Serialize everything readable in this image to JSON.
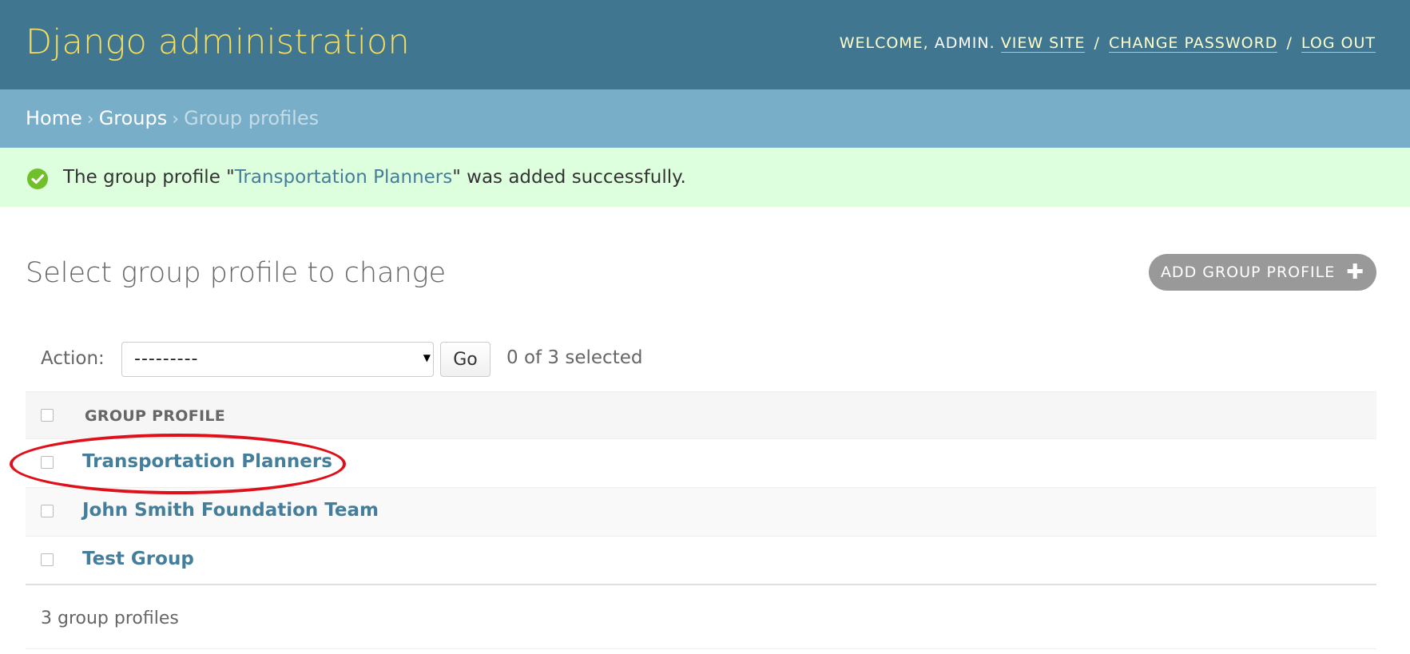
{
  "header": {
    "brand": "Django administration",
    "welcome_prefix": "Welcome,",
    "user_name": "admin",
    "user_suffix": ".",
    "view_site": "View site",
    "change_password": "Change password",
    "log_out": "Log out",
    "separator": "/"
  },
  "breadcrumbs": {
    "home": "Home",
    "groups": "Groups",
    "current": "Group profiles",
    "arrow": "›"
  },
  "message": {
    "icon": "check-circle-icon",
    "prefix": "The group profile \"",
    "link": "Transportation Planners",
    "suffix": "\" was added successfully.",
    "color": "#70bf2b"
  },
  "page": {
    "title": "Select group profile to change",
    "add_button": "Add group profile",
    "add_icon": "✚"
  },
  "actions": {
    "label": "Action:",
    "selected_value": "---------",
    "go_label": "Go",
    "counter": "0 of 3 selected"
  },
  "table": {
    "column_header": "Group profile",
    "rows": [
      {
        "name": "Transportation Planners"
      },
      {
        "name": "John Smith Foundation Team"
      },
      {
        "name": "Test Group"
      }
    ]
  },
  "paginator": {
    "text": "3 group profiles"
  },
  "colors": {
    "header_bg": "#417690",
    "brand": "#f5dd5d",
    "breadcrumbs_bg": "#79aec8",
    "message_bg": "#ddffdd",
    "link": "#447e9b",
    "annotation": "#e0101b"
  }
}
